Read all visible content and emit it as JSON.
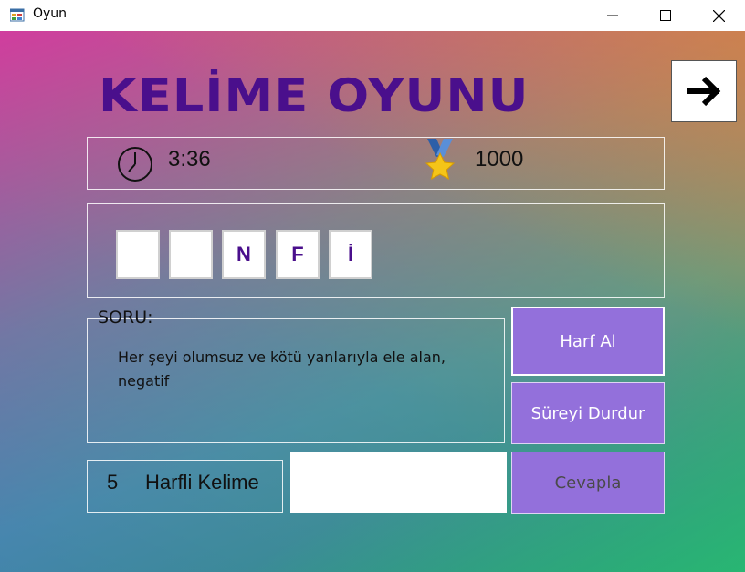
{
  "window": {
    "title": "Oyun",
    "icon": "windows-forms-app-icon",
    "controls": {
      "minimize": "minimize-icon",
      "maximize": "maximize-icon",
      "close": "close-icon"
    }
  },
  "game": {
    "title": "KELİME OYUNU",
    "next_icon": "arrow-right-icon"
  },
  "stats": {
    "timer_icon": "clock-icon",
    "timer": "3:36",
    "score_icon": "medal-icon",
    "score": "1000"
  },
  "tiles": [
    "",
    "",
    "N",
    "F",
    "İ"
  ],
  "question": {
    "legend": "SORU:",
    "text": "Her şeyi olumsuz ve kötü yanlarıyla ele alan, negatif"
  },
  "buttons": {
    "hint": "Harf Al",
    "pause": "Süreyi Durdur",
    "answer": "Cevapla"
  },
  "word_length": {
    "count": "5",
    "label": "Harfli Kelime"
  },
  "answer_input": {
    "value": ""
  },
  "colors": {
    "title_color": "#4a0f8c",
    "button_bg": "#9370db",
    "tile_letter": "#4a0f8c"
  }
}
